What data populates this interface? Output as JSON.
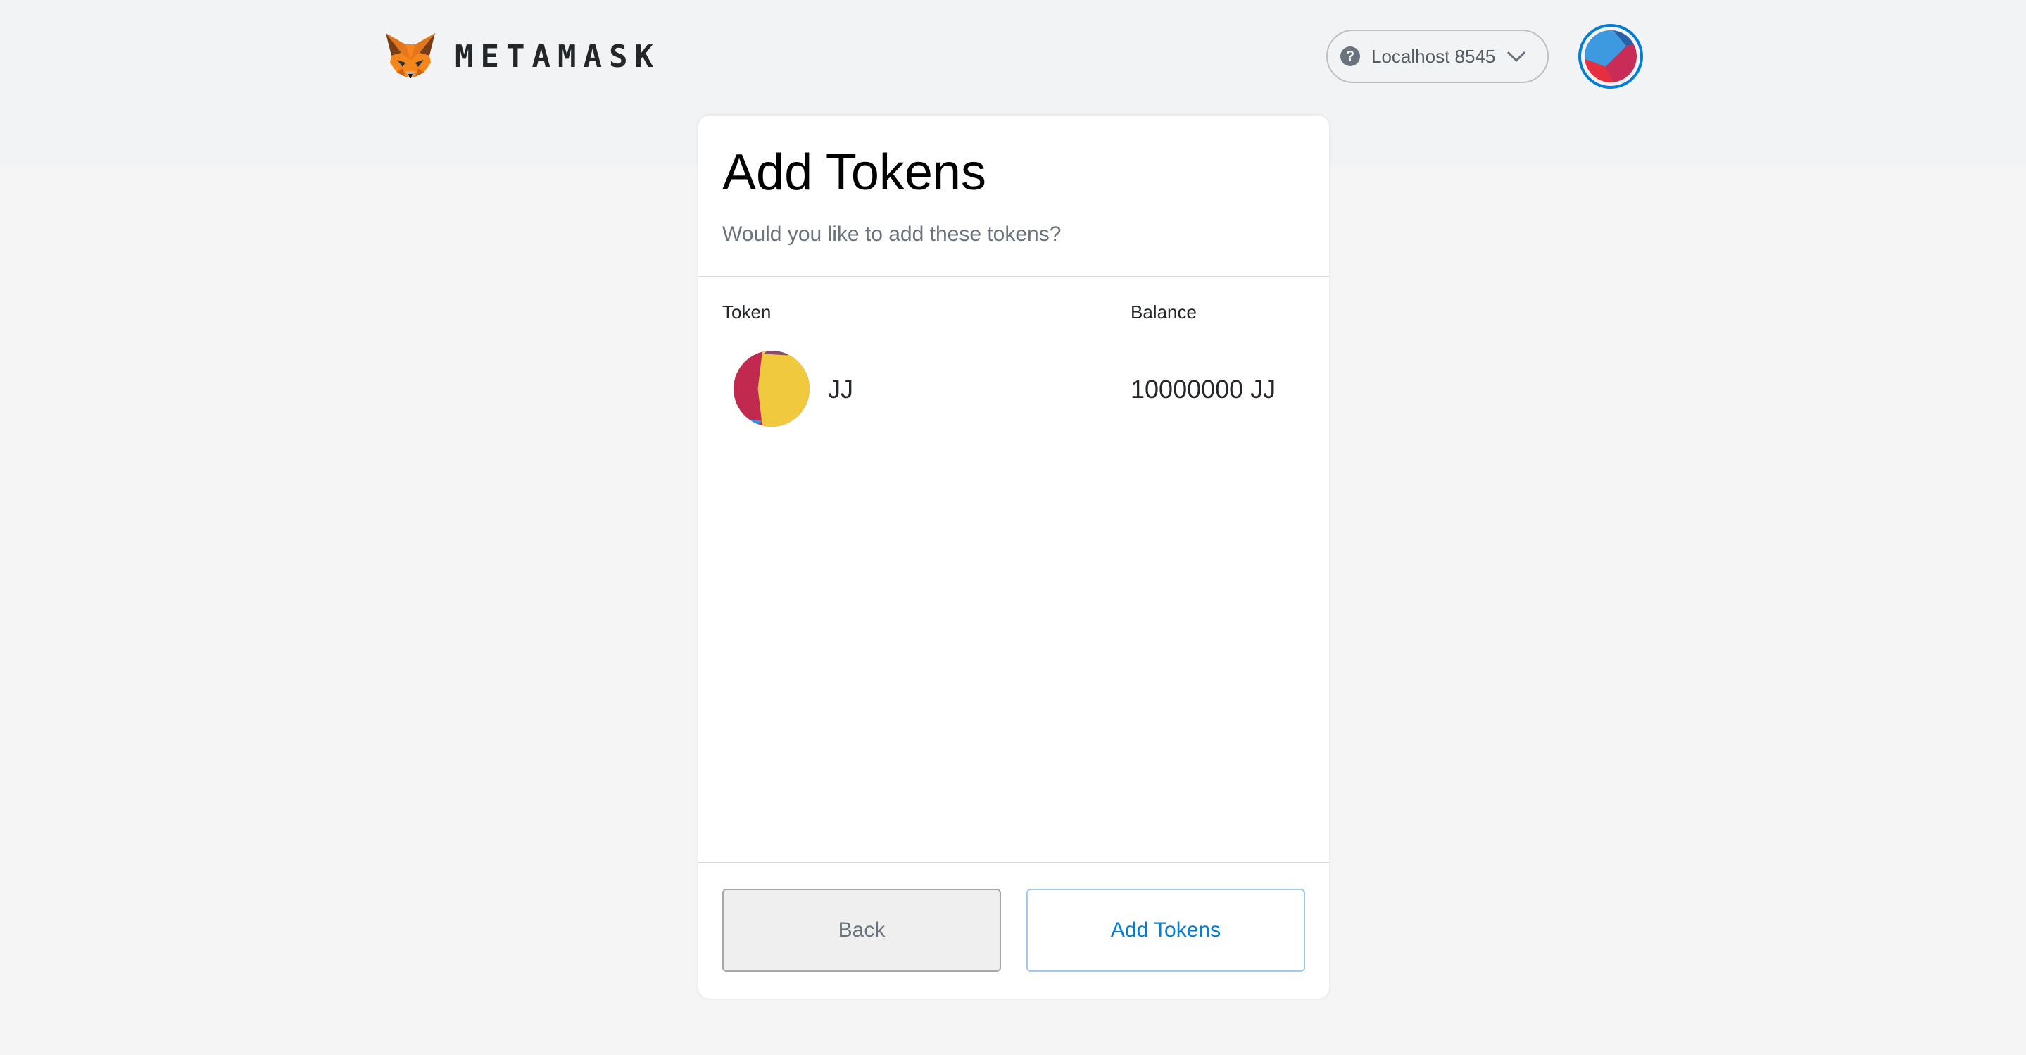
{
  "header": {
    "brand": "METAMASK",
    "network": {
      "label": "Localhost 8545",
      "help_glyph": "?"
    }
  },
  "main": {
    "title": "Add Tokens",
    "subtitle": "Would you like to add these tokens?",
    "columns": {
      "token": "Token",
      "balance": "Balance"
    },
    "tokens": [
      {
        "symbol": "JJ",
        "balance": "10000000 JJ"
      }
    ]
  },
  "footer": {
    "back_label": "Back",
    "add_label": "Add Tokens"
  },
  "colors": {
    "accent": "#037dd6",
    "band": "#f2f3f4",
    "background": "#f5f5f6"
  },
  "icons": {
    "logo": "metamask-fox-icon",
    "help": "question-circle-icon",
    "chevron": "chevron-down-icon",
    "account": "account-identicon",
    "token": "token-identicon"
  }
}
